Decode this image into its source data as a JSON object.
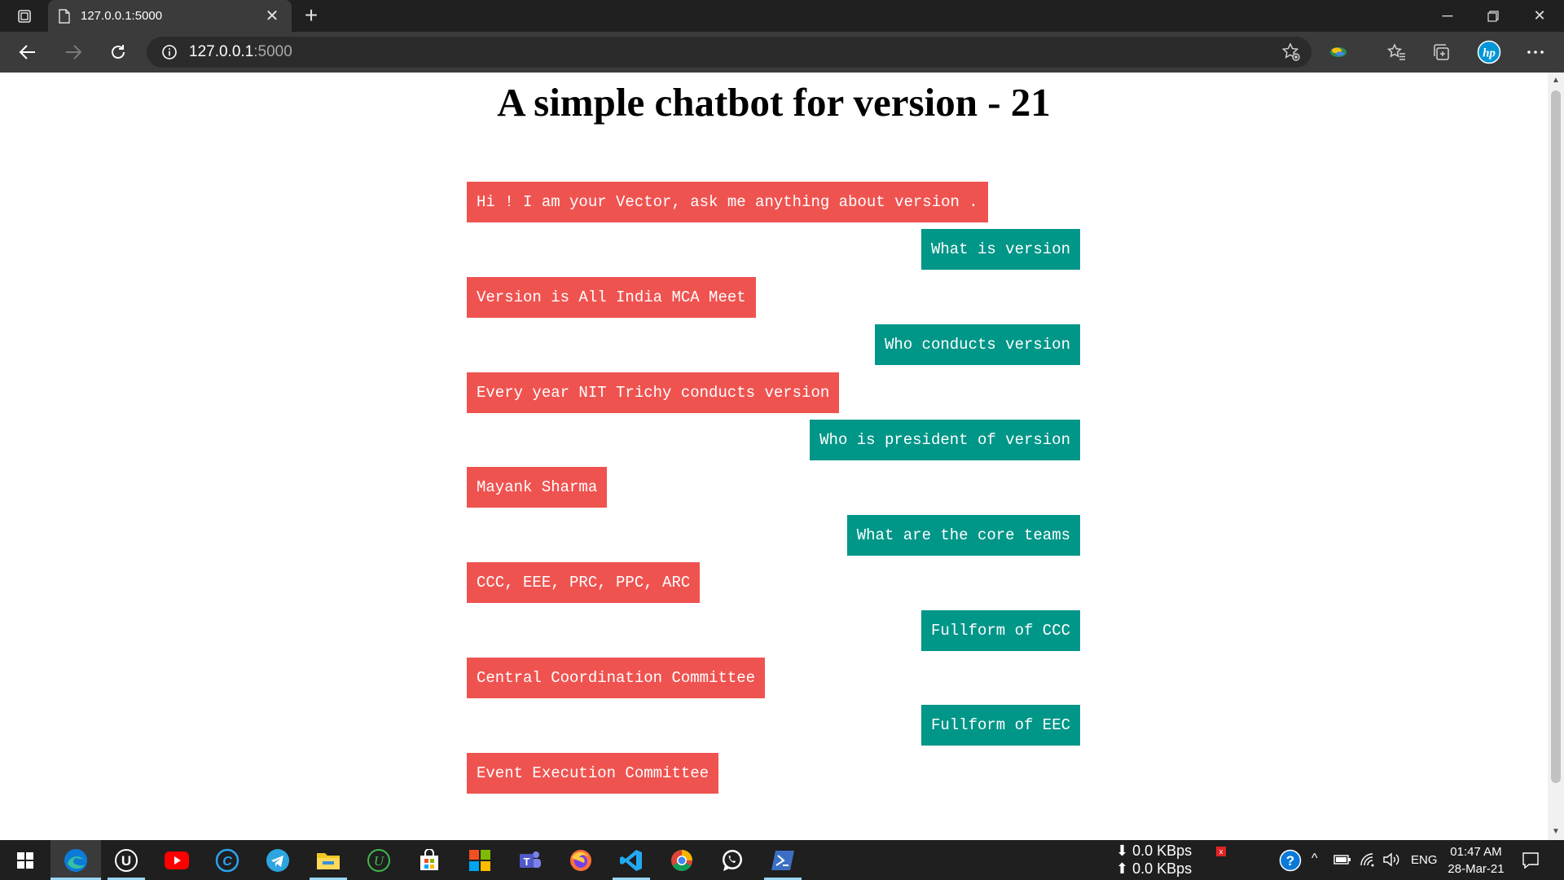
{
  "browser": {
    "tab_title": "127.0.0.1:5000",
    "address_host": "127.0.0.1",
    "address_port": ":5000"
  },
  "page": {
    "title": "A simple chatbot for version - 21"
  },
  "chat": {
    "messages": [
      {
        "sender": "bot",
        "text": "Hi ! I am your Vector, ask me anything about version ."
      },
      {
        "sender": "user",
        "text": "What is version"
      },
      {
        "sender": "bot",
        "text": "Version is All India MCA Meet"
      },
      {
        "sender": "user",
        "text": "Who conducts version"
      },
      {
        "sender": "bot",
        "text": "Every year NIT Trichy conducts version"
      },
      {
        "sender": "user",
        "text": "Who is president of version"
      },
      {
        "sender": "bot",
        "text": "Mayank Sharma"
      },
      {
        "sender": "user",
        "text": "What are the core teams"
      },
      {
        "sender": "bot",
        "text": "CCC, EEE, PRC, PPC, ARC"
      },
      {
        "sender": "user",
        "text": "Fullform of CCC"
      },
      {
        "sender": "bot",
        "text": "Central Coordination Committee"
      },
      {
        "sender": "user",
        "text": "Fullform of EEC"
      },
      {
        "sender": "bot",
        "text": "Event Execution Committee"
      }
    ]
  },
  "colors": {
    "bot_bubble": "#ef5350",
    "user_bubble": "#009688"
  },
  "taskbar": {
    "apps": [
      "start-icon",
      "edge-icon",
      "unreal-icon",
      "youtube-icon",
      "ccleaner-icon",
      "telegram-icon",
      "file-explorer-icon",
      "upwork-icon",
      "store-icon",
      "office-icon",
      "teams-icon",
      "firefox-icon",
      "vscode-icon",
      "chrome-icon",
      "whatsapp-icon",
      "powershell-icon"
    ],
    "net_down": "⬇ 0.0 KBps",
    "net_up": "⬆ 0.0 KBps",
    "language": "ENG",
    "time": "01:47 AM",
    "date": "28-Mar-21"
  }
}
